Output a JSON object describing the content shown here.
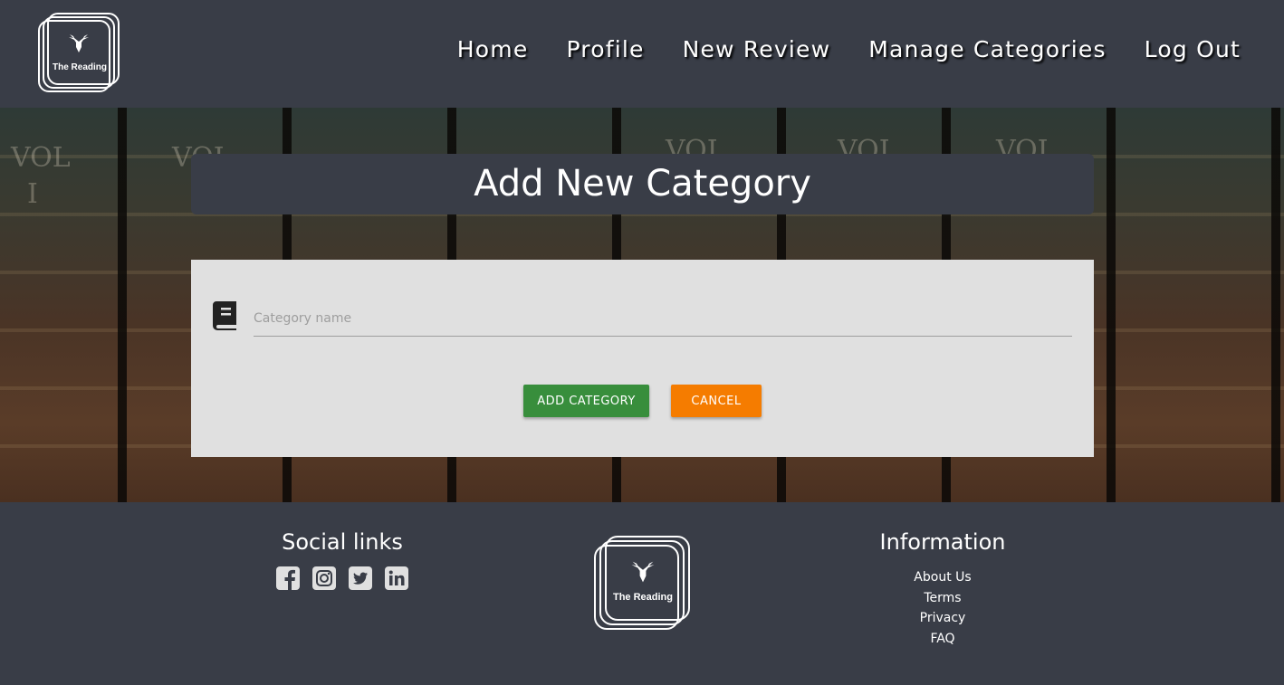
{
  "brand": {
    "logo_text": "The Reading"
  },
  "nav": {
    "items": [
      {
        "label": "Home"
      },
      {
        "label": "Profile"
      },
      {
        "label": "New Review"
      },
      {
        "label": "Manage Categories"
      },
      {
        "label": "Log Out"
      }
    ]
  },
  "hero": {
    "spines": [
      "VOL",
      "I",
      "VOL",
      "VOL",
      "VOL",
      "VOL"
    ]
  },
  "page": {
    "title": "Add New Category"
  },
  "form": {
    "category_placeholder": "Category name",
    "category_value": "",
    "add_label": "ADD CATEGORY",
    "cancel_label": "CANCEL"
  },
  "footer": {
    "social_heading": "Social links",
    "social_icons": [
      "facebook-icon",
      "instagram-icon",
      "twitter-icon",
      "linkedin-icon"
    ],
    "info_heading": "Information",
    "info_links": [
      "About Us",
      "Terms",
      "Privacy",
      "FAQ"
    ],
    "logo_text": "The Reading"
  },
  "colors": {
    "primary_bg": "#393d47",
    "card_bg": "#e0e0e0",
    "add_button": "#388e3c",
    "cancel_button": "#f57c00"
  }
}
